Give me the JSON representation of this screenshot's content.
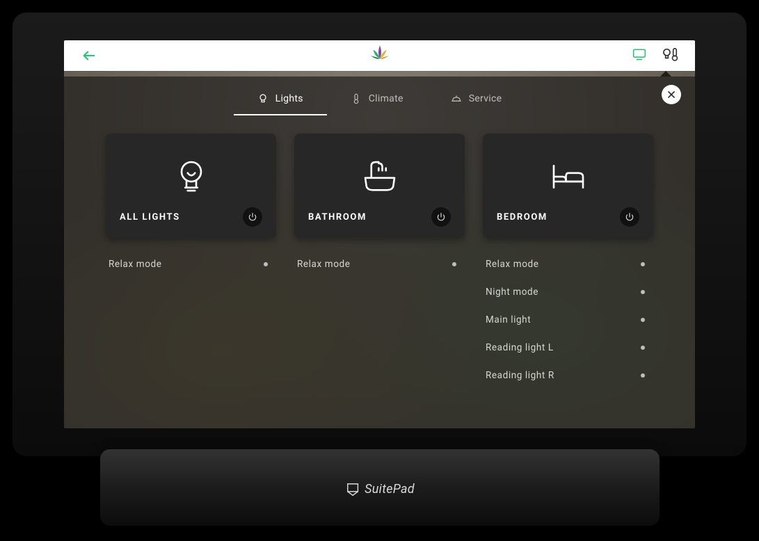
{
  "device": {
    "brand": "SuitePad"
  },
  "topbar": {
    "back_icon": "arrow-left",
    "tv_icon": "tv",
    "room_control_icon": "bulb-thermometer"
  },
  "panel": {
    "close_icon": "close",
    "tabs": [
      {
        "id": "lights",
        "label": "Lights",
        "icon": "bulb",
        "active": true
      },
      {
        "id": "climate",
        "label": "Climate",
        "icon": "thermometer",
        "active": false
      },
      {
        "id": "service",
        "label": "Service",
        "icon": "bell",
        "active": false
      }
    ]
  },
  "columns": [
    {
      "id": "all",
      "card": {
        "title": "ALL LIGHTS",
        "icon": "bulb"
      },
      "modes": [
        {
          "label": "Relax mode"
        }
      ]
    },
    {
      "id": "bathroom",
      "card": {
        "title": "BATHROOM",
        "icon": "bathtub"
      },
      "modes": [
        {
          "label": "Relax mode"
        }
      ]
    },
    {
      "id": "bedroom",
      "card": {
        "title": "BEDROOM",
        "icon": "bed"
      },
      "modes": [
        {
          "label": "Relax mode"
        },
        {
          "label": "Night mode"
        },
        {
          "label": "Main light"
        },
        {
          "label": "Reading light L"
        },
        {
          "label": "Reading light R"
        }
      ]
    }
  ]
}
